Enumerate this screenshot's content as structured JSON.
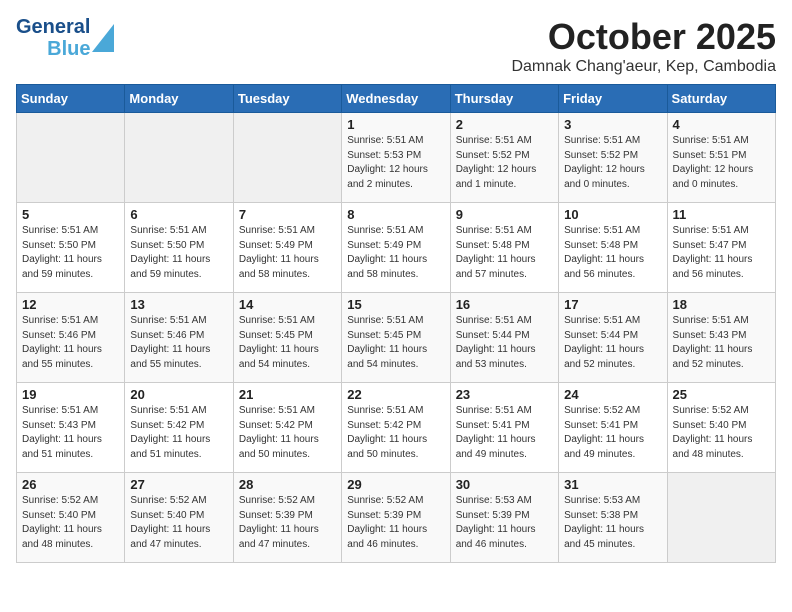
{
  "header": {
    "logo_line1": "General",
    "logo_line2": "Blue",
    "month": "October 2025",
    "location": "Damnak Chang'aeur, Kep, Cambodia"
  },
  "days_of_week": [
    "Sunday",
    "Monday",
    "Tuesday",
    "Wednesday",
    "Thursday",
    "Friday",
    "Saturday"
  ],
  "weeks": [
    [
      {
        "day": "",
        "empty": true
      },
      {
        "day": "",
        "empty": true
      },
      {
        "day": "",
        "empty": true
      },
      {
        "day": "1",
        "sunrise": "5:51 AM",
        "sunset": "5:53 PM",
        "daylight": "12 hours and 2 minutes."
      },
      {
        "day": "2",
        "sunrise": "5:51 AM",
        "sunset": "5:52 PM",
        "daylight": "12 hours and 1 minute."
      },
      {
        "day": "3",
        "sunrise": "5:51 AM",
        "sunset": "5:52 PM",
        "daylight": "12 hours and 0 minutes."
      },
      {
        "day": "4",
        "sunrise": "5:51 AM",
        "sunset": "5:51 PM",
        "daylight": "12 hours and 0 minutes."
      }
    ],
    [
      {
        "day": "5",
        "sunrise": "5:51 AM",
        "sunset": "5:50 PM",
        "daylight": "11 hours and 59 minutes."
      },
      {
        "day": "6",
        "sunrise": "5:51 AM",
        "sunset": "5:50 PM",
        "daylight": "11 hours and 59 minutes."
      },
      {
        "day": "7",
        "sunrise": "5:51 AM",
        "sunset": "5:49 PM",
        "daylight": "11 hours and 58 minutes."
      },
      {
        "day": "8",
        "sunrise": "5:51 AM",
        "sunset": "5:49 PM",
        "daylight": "11 hours and 58 minutes."
      },
      {
        "day": "9",
        "sunrise": "5:51 AM",
        "sunset": "5:48 PM",
        "daylight": "11 hours and 57 minutes."
      },
      {
        "day": "10",
        "sunrise": "5:51 AM",
        "sunset": "5:48 PM",
        "daylight": "11 hours and 56 minutes."
      },
      {
        "day": "11",
        "sunrise": "5:51 AM",
        "sunset": "5:47 PM",
        "daylight": "11 hours and 56 minutes."
      }
    ],
    [
      {
        "day": "12",
        "sunrise": "5:51 AM",
        "sunset": "5:46 PM",
        "daylight": "11 hours and 55 minutes."
      },
      {
        "day": "13",
        "sunrise": "5:51 AM",
        "sunset": "5:46 PM",
        "daylight": "11 hours and 55 minutes."
      },
      {
        "day": "14",
        "sunrise": "5:51 AM",
        "sunset": "5:45 PM",
        "daylight": "11 hours and 54 minutes."
      },
      {
        "day": "15",
        "sunrise": "5:51 AM",
        "sunset": "5:45 PM",
        "daylight": "11 hours and 54 minutes."
      },
      {
        "day": "16",
        "sunrise": "5:51 AM",
        "sunset": "5:44 PM",
        "daylight": "11 hours and 53 minutes."
      },
      {
        "day": "17",
        "sunrise": "5:51 AM",
        "sunset": "5:44 PM",
        "daylight": "11 hours and 52 minutes."
      },
      {
        "day": "18",
        "sunrise": "5:51 AM",
        "sunset": "5:43 PM",
        "daylight": "11 hours and 52 minutes."
      }
    ],
    [
      {
        "day": "19",
        "sunrise": "5:51 AM",
        "sunset": "5:43 PM",
        "daylight": "11 hours and 51 minutes."
      },
      {
        "day": "20",
        "sunrise": "5:51 AM",
        "sunset": "5:42 PM",
        "daylight": "11 hours and 51 minutes."
      },
      {
        "day": "21",
        "sunrise": "5:51 AM",
        "sunset": "5:42 PM",
        "daylight": "11 hours and 50 minutes."
      },
      {
        "day": "22",
        "sunrise": "5:51 AM",
        "sunset": "5:42 PM",
        "daylight": "11 hours and 50 minutes."
      },
      {
        "day": "23",
        "sunrise": "5:51 AM",
        "sunset": "5:41 PM",
        "daylight": "11 hours and 49 minutes."
      },
      {
        "day": "24",
        "sunrise": "5:52 AM",
        "sunset": "5:41 PM",
        "daylight": "11 hours and 49 minutes."
      },
      {
        "day": "25",
        "sunrise": "5:52 AM",
        "sunset": "5:40 PM",
        "daylight": "11 hours and 48 minutes."
      }
    ],
    [
      {
        "day": "26",
        "sunrise": "5:52 AM",
        "sunset": "5:40 PM",
        "daylight": "11 hours and 48 minutes."
      },
      {
        "day": "27",
        "sunrise": "5:52 AM",
        "sunset": "5:40 PM",
        "daylight": "11 hours and 47 minutes."
      },
      {
        "day": "28",
        "sunrise": "5:52 AM",
        "sunset": "5:39 PM",
        "daylight": "11 hours and 47 minutes."
      },
      {
        "day": "29",
        "sunrise": "5:52 AM",
        "sunset": "5:39 PM",
        "daylight": "11 hours and 46 minutes."
      },
      {
        "day": "30",
        "sunrise": "5:53 AM",
        "sunset": "5:39 PM",
        "daylight": "11 hours and 46 minutes."
      },
      {
        "day": "31",
        "sunrise": "5:53 AM",
        "sunset": "5:38 PM",
        "daylight": "11 hours and 45 minutes."
      },
      {
        "day": "",
        "empty": true
      }
    ]
  ]
}
